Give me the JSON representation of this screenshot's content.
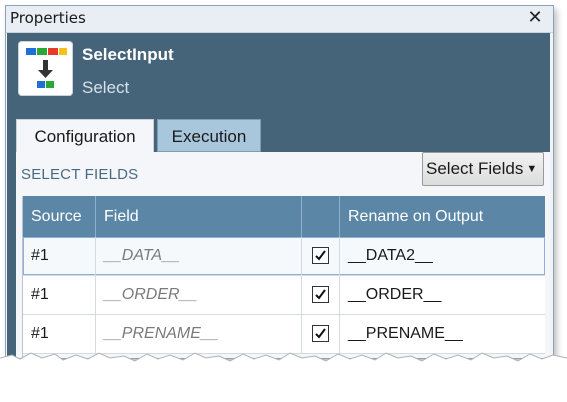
{
  "panel": {
    "title": "Properties",
    "close_icon": "close-icon"
  },
  "tool": {
    "icon": "select-input-tool-icon",
    "name": "SelectInput",
    "type": "Select"
  },
  "tabs": [
    {
      "label": "Configuration",
      "active": true
    },
    {
      "label": "Execution",
      "active": false
    }
  ],
  "section": {
    "label": "SELECT FIELDS",
    "select_fields_button": "Select Fields",
    "caret_icon": "chevron-down-icon"
  },
  "grid": {
    "columns": [
      "Source",
      "Field",
      "",
      "Rename on Output"
    ],
    "rows": [
      {
        "source": "#1",
        "field": "__DATA__",
        "checked": true,
        "rename": "__DATA2__"
      },
      {
        "source": "#1",
        "field": "__ORDER__",
        "checked": true,
        "rename": "__ORDER__"
      },
      {
        "source": "#1",
        "field": "__PRENAME__",
        "checked": true,
        "rename": "__PRENAME__"
      }
    ]
  },
  "colors": {
    "header_bg": "#456479",
    "grid_header_bg": "#5b86a6",
    "inactive_tab_bg": "#a9c7dc"
  }
}
